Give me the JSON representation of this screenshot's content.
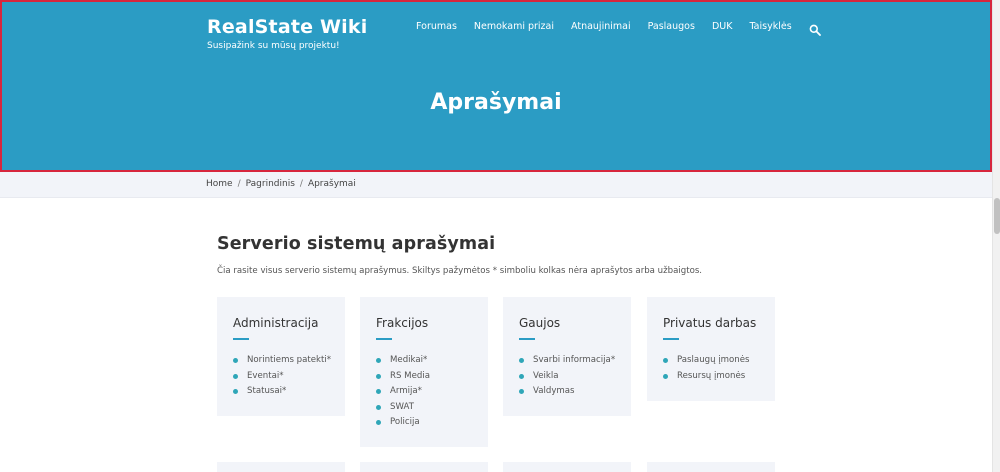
{
  "site": {
    "title": "RealState Wiki",
    "tagline": "Susipažink su mūsų projektu!"
  },
  "nav": {
    "items": [
      "Forumas",
      "Nemokami prizai",
      "Atnaujinimai",
      "Paslaugos",
      "DUK",
      "Taisyklės"
    ]
  },
  "hero": {
    "title": "Aprašymai"
  },
  "breadcrumb": {
    "items": [
      "Home",
      "Pagrindinis",
      "Aprašymai"
    ],
    "separator": "/"
  },
  "section": {
    "title": "Serverio sistemų aprašymai",
    "intro": "Čia rasite visus serverio sistemų aprašymus. Skiltys pažymėtos * simboliu kolkas nėra aprašytos arba užbaigtos."
  },
  "cards": [
    {
      "title": "Administracija",
      "items": [
        "Norintiems patekti*",
        "Eventai*",
        "Statusai*"
      ]
    },
    {
      "title": "Frakcijos",
      "items": [
        "Medikai*",
        "RS Media",
        "Armija*",
        "SWAT",
        "Policija"
      ]
    },
    {
      "title": "Gaujos",
      "items": [
        "Svarbi informacija*",
        "Veikla",
        "Valdymas"
      ]
    },
    {
      "title": "Privatus darbas",
      "items": [
        "Paslaugų įmonės",
        "Resursų įmonės"
      ]
    }
  ],
  "colors": {
    "hero": "#2b9cc4",
    "accent": "#2fa6b8",
    "card_bg": "#f2f4f9",
    "highlight_border": "#d7263d"
  },
  "icons": {
    "search": "search-icon",
    "bullet": "bullet-dot-icon"
  }
}
